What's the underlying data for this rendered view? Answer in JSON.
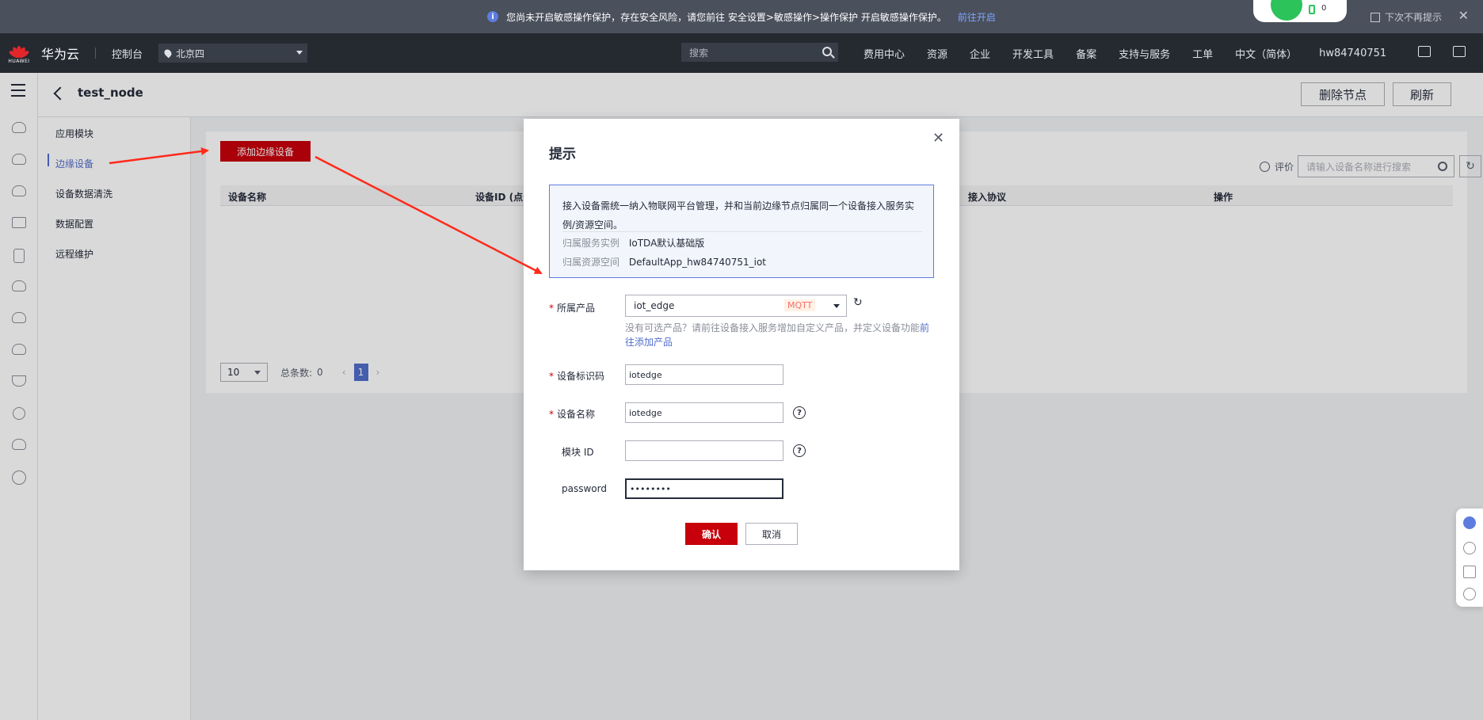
{
  "notice": {
    "message": "您尚未开启敏感操作保护，存在安全风险，请您前往 安全设置>敏感操作>操作保护 开启敏感操作保护。",
    "link": "前往开启",
    "skip_label": "下次不再提示",
    "widget_count": "0"
  },
  "header": {
    "logo_text": "HUAWEI",
    "brand": "华为云",
    "console": "控制台",
    "region": "北京四",
    "search_placeholder": "搜索",
    "nav": [
      "费用中心",
      "资源",
      "企业",
      "开发工具",
      "备案",
      "支持与服务",
      "工单",
      "中文（简体）",
      "hw84740751"
    ]
  },
  "page": {
    "title": "test_node",
    "delete_node": "删除节点",
    "refresh": "刷新"
  },
  "submenu": [
    "应用模块",
    "边缘设备",
    "设备数据清洗",
    "数据配置",
    "远程维护"
  ],
  "table": {
    "add_button": "添加边缘设备",
    "rate": "评价",
    "search_placeholder": "请输入设备名称进行搜索",
    "columns": [
      "设备名称",
      "设备ID (点击",
      "接入协议",
      "操作"
    ],
    "page_size": "10",
    "total_label": "总条数:",
    "total": "0",
    "current_page": "1"
  },
  "modal": {
    "title": "提示",
    "notice": "接入设备需统一纳入物联网平台管理，并和当前边缘节点归属同一个设备接入服务实例/资源空间。",
    "service_instance_label": "归属服务实例",
    "service_instance": "IoTDA默认基础版",
    "resource_space_label": "归属资源空间",
    "resource_space": "DefaultApp_hw84740751_iot",
    "product_label": "所属产品",
    "product_value": "iot_edge",
    "product_tag": "MQTT",
    "hint": "没有可选产品？请前往设备接入服务增加自定义产品，并定义设备功能",
    "hint_link": "前往添加产品",
    "device_id_label": "设备标识码",
    "device_id_value": "iotedge",
    "device_name_label": "设备名称",
    "device_name_value": "iotedge",
    "module_id_label": "模块 ID",
    "module_id_value": "",
    "password_label": "password",
    "password_value": "••••••••",
    "confirm": "确认",
    "cancel": "取消"
  },
  "colors": {
    "brand_red": "#c7000b",
    "accent_blue": "#526ecc",
    "annotation_arrow": "#ff2a1a"
  }
}
